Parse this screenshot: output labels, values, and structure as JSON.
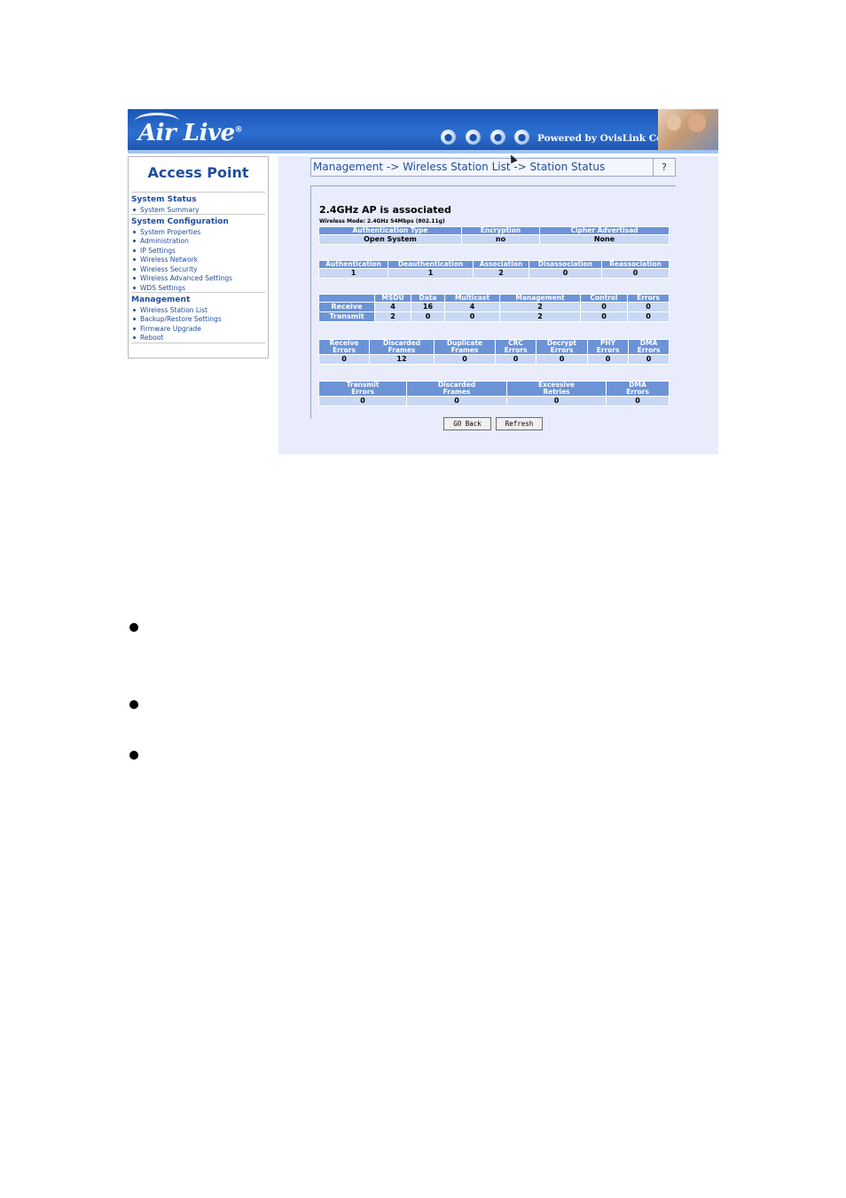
{
  "header": {
    "logo": "Air Live",
    "logo_mark": "®",
    "powered_by": "Powered by OvisLink Corp."
  },
  "sidebar": {
    "title": "Access Point",
    "sections": [
      {
        "heading": "System Status",
        "items": [
          "System Summary"
        ]
      },
      {
        "heading": "System Configuration",
        "items": [
          "System Properties",
          "Administration",
          "IP Settings",
          "Wireless Network",
          "Wireless Security",
          "Wireless Advanced Settings",
          "WDS Settings"
        ]
      },
      {
        "heading": "Management",
        "items": [
          "Wireless Station List",
          "Backup/Restore Settings",
          "Firmware Upgrade",
          "Reboot"
        ]
      }
    ]
  },
  "breadcrumb": {
    "text": "Management -> Wireless Station List -> Station Status",
    "help": "?"
  },
  "station": {
    "status": "2.4GHz AP is  associated",
    "mode": "Wireless Mode: 2.4GHz 54Mbps (802.11g)"
  },
  "tables": {
    "security": {
      "headers": [
        "Authentication Type",
        "Encryption",
        "Cipher Advertisad"
      ],
      "values": [
        "Open System",
        "no",
        "None"
      ]
    },
    "events": {
      "headers": [
        "Authentication",
        "Deauthentication",
        "Association",
        "Disassociation",
        "Reassociation"
      ],
      "values": [
        "1",
        "1",
        "2",
        "0",
        "0"
      ]
    },
    "traffic": {
      "headers": [
        "",
        "MSDU",
        "Data",
        "Multicast",
        "Management",
        "Control",
        "Errors"
      ],
      "rows": [
        [
          "Receive",
          "4",
          "16",
          "4",
          "2",
          "0",
          "0"
        ],
        [
          "Transmit",
          "2",
          "0",
          "0",
          "2",
          "0",
          "0"
        ]
      ]
    },
    "rx_errors": {
      "headers": [
        [
          "Receive",
          "Errors"
        ],
        [
          "Discarded",
          "Frames"
        ],
        [
          "Duplicate",
          "Frames"
        ],
        [
          "CRC",
          "Errors"
        ],
        [
          "Decrypt",
          "Errors"
        ],
        [
          "PHY",
          "Errors"
        ],
        [
          "DMA",
          "Errors"
        ]
      ],
      "values": [
        "0",
        "12",
        "0",
        "0",
        "0",
        "0",
        "0"
      ]
    },
    "tx_errors": {
      "headers": [
        [
          "Transmit",
          "Errors"
        ],
        [
          "Discarded",
          "Frames"
        ],
        [
          "Excessive",
          "Retries"
        ],
        [
          "DMA",
          "Errors"
        ]
      ],
      "values": [
        "0",
        "0",
        "0",
        "0"
      ]
    }
  },
  "buttons": {
    "go_back": "GO Back",
    "refresh": "Refresh"
  },
  "colors": {
    "header_blue": "#2d6fd0",
    "table_header": "#6c93d6",
    "table_cell": "#c8d8f4",
    "link": "#1f4e9a"
  }
}
